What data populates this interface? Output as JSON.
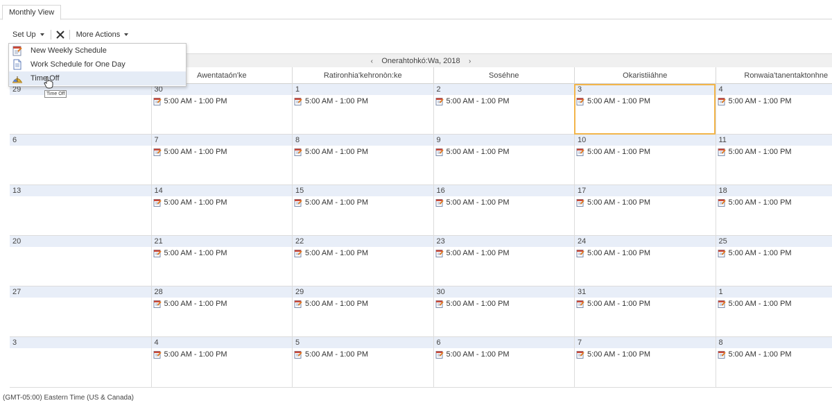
{
  "tabs": [
    {
      "label": "Monthly View",
      "active": true
    }
  ],
  "toolbar": {
    "setup_label": "Set Up",
    "more_actions_label": "More Actions",
    "delete_icon": "x-icon"
  },
  "menu": {
    "items": [
      {
        "label": "New Weekly Schedule",
        "icon": "schedule-icon"
      },
      {
        "label": "Work Schedule for One Day",
        "icon": "document-icon"
      },
      {
        "label": "Time Off",
        "icon": "time-off-icon",
        "hovered": true
      }
    ],
    "tooltip": "Time Off"
  },
  "calendar": {
    "month_label": "Onerahtohkó:Wa, 2018",
    "prev_icon": "chevron-left-icon",
    "next_icon": "chevron-right-icon",
    "columns": [
      "",
      "Awentataón'ke",
      "Ratironhia'kehronòn:ke",
      "Soséhne",
      "Okaristiiáhne",
      "Ronwaia'tanentaktonhne"
    ],
    "entry_label": "5:00 AM - 1:00 PM",
    "today_row": 0,
    "today_col": 4,
    "weeks": [
      {
        "days": [
          "29",
          "30",
          "1",
          "2",
          "3",
          "4"
        ],
        "entries": [
          false,
          true,
          true,
          true,
          true,
          true
        ]
      },
      {
        "days": [
          "6",
          "7",
          "8",
          "9",
          "10",
          "11"
        ],
        "entries": [
          false,
          true,
          true,
          true,
          true,
          true
        ]
      },
      {
        "days": [
          "13",
          "14",
          "15",
          "16",
          "17",
          "18"
        ],
        "entries": [
          false,
          true,
          true,
          true,
          true,
          true
        ]
      },
      {
        "days": [
          "20",
          "21",
          "22",
          "23",
          "24",
          "25"
        ],
        "entries": [
          false,
          true,
          true,
          true,
          true,
          true
        ]
      },
      {
        "days": [
          "27",
          "28",
          "29",
          "30",
          "31",
          "1"
        ],
        "entries": [
          false,
          true,
          true,
          true,
          true,
          true
        ]
      },
      {
        "days": [
          "3",
          "4",
          "5",
          "6",
          "7",
          "8"
        ],
        "entries": [
          false,
          true,
          true,
          true,
          true,
          true
        ]
      }
    ]
  },
  "footer": {
    "timezone": "(GMT-05:00) Eastern Time (US & Canada)"
  }
}
